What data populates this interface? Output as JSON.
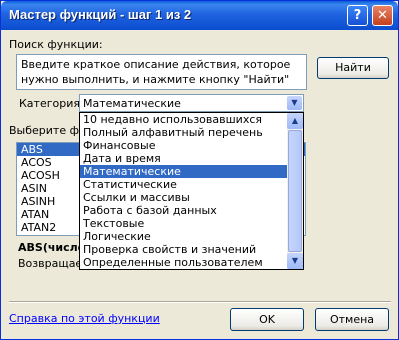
{
  "window": {
    "title": "Мастер функций - шаг 1 из 2",
    "help_btn": "?",
    "close_btn": "✕"
  },
  "search": {
    "label": "Поиск функции:",
    "description": "Введите краткое описание действия, которое нужно выполнить, и нажмите кнопку \"Найти\"",
    "find_button": "Найти"
  },
  "category": {
    "label": "Категория:",
    "selected": "Математические",
    "options": [
      "10 недавно использовавшихся",
      "Полный алфавитный перечень",
      "Финансовые",
      "Дата и время",
      "Математические",
      "Статистические",
      "Ссылки и массивы",
      "Работа с базой данных",
      "Текстовые",
      "Логические",
      "Проверка свойств и значений",
      "Определенные пользователем"
    ],
    "selected_index": 4
  },
  "functions": {
    "label": "Выберите фу",
    "items": [
      "ABS",
      "ACOS",
      "ACOSH",
      "ASIN",
      "ASINH",
      "ATAN",
      "ATAN2"
    ],
    "selected": "ABS"
  },
  "syntax": {
    "signature": "ABS(число",
    "description": "Возвращает"
  },
  "footer": {
    "help_link": "Справка по этой функции",
    "ok": "OK",
    "cancel": "Отмена"
  },
  "colors": {
    "titlebar": "#0b4dcf",
    "selection": "#316ac5",
    "dialog_bg": "#ece9d8",
    "link": "#0000ff"
  }
}
